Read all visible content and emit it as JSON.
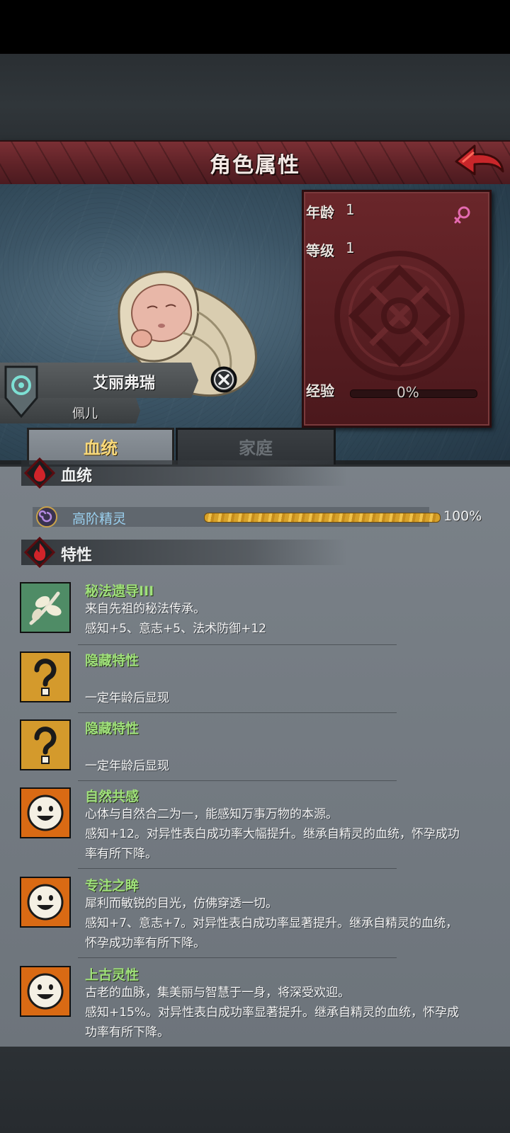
{
  "header": {
    "title": "角色属性"
  },
  "character": {
    "name": "艾丽弗瑞",
    "subtitle": "佩儿",
    "age_label": "年龄",
    "age_value": "1",
    "level_label": "等级",
    "level_value": "1",
    "exp_label": "经验",
    "exp_value": "0%",
    "exp_progress": 0
  },
  "tabs": [
    {
      "label": "血统",
      "active": true
    },
    {
      "label": "家庭",
      "active": false
    }
  ],
  "lineage": {
    "section_title": "血统",
    "name": "高阶精灵",
    "percent": "100%",
    "progress": 1.0
  },
  "traits_section": {
    "title": "特性"
  },
  "traits": [
    {
      "icon": "leaf-branch-icon",
      "name": "秘法遗导III",
      "desc": "来自先祖的秘法传承。",
      "effect": "感知+5、意志+5、法术防御+12"
    },
    {
      "icon": "question-mark-icon",
      "name": "隐藏特性",
      "desc": "",
      "effect": "一定年龄后显现"
    },
    {
      "icon": "question-mark-icon",
      "name": "隐藏特性",
      "desc": "",
      "effect": "一定年龄后显现"
    },
    {
      "icon": "smiley-sun-icon",
      "name": "自然共感",
      "desc": "心体与自然合二为一，能感知万事万物的本源。",
      "effect": "感知+12。对异性表白成功率大幅提升。继承自精灵的血统，怀孕成功",
      "effect2": "率有所下降。"
    },
    {
      "icon": "smiley-sun-icon",
      "name": "专注之眸",
      "desc": "犀利而敏锐的目光，仿佛穿透一切。",
      "effect": "感知+7、意志+7。对异性表白成功率显著提升。继承自精灵的血统，",
      "effect2": "怀孕成功率有所下降。"
    },
    {
      "icon": "smiley-sun-icon",
      "name": "上古灵性",
      "desc": "古老的血脉，集美丽与智慧于一身，将深受欢迎。",
      "effect": "感知+15%。对异性表白成功率显著提升。继承自精灵的血统，怀孕成",
      "effect2": "功率有所下降。"
    }
  ],
  "colors": {
    "title_bar": "#5e2227",
    "stats_panel": "#5a1f23",
    "tab_active_text": "#f7d87a",
    "trait_name": "#9fe07a",
    "lineage_name": "#9ad0ef",
    "lineage_bar": "#e8b23a"
  }
}
